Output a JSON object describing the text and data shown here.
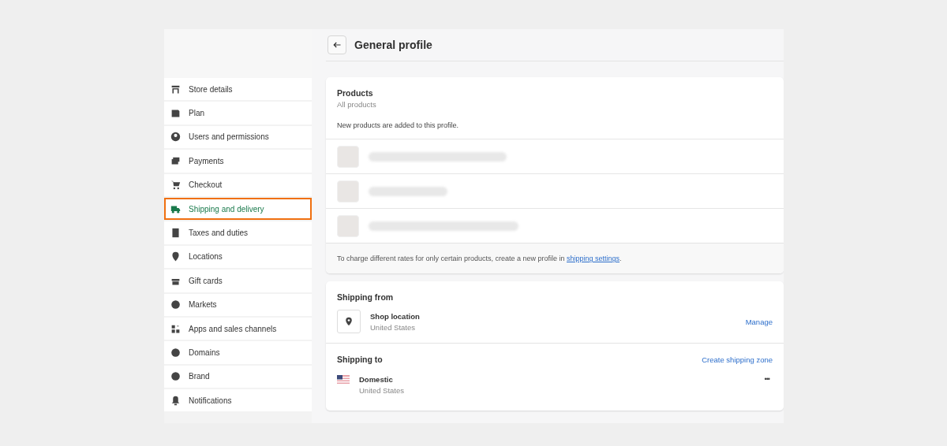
{
  "sidebar": {
    "items": [
      {
        "label": "Store details",
        "selected": false
      },
      {
        "label": "Plan",
        "selected": false
      },
      {
        "label": "Users and permissions",
        "selected": false
      },
      {
        "label": "Payments",
        "selected": false
      },
      {
        "label": "Checkout",
        "selected": false
      },
      {
        "label": "Shipping and delivery",
        "selected": true
      },
      {
        "label": "Taxes and duties",
        "selected": false
      },
      {
        "label": "Locations",
        "selected": false
      },
      {
        "label": "Gift cards",
        "selected": false
      },
      {
        "label": "Markets",
        "selected": false
      },
      {
        "label": "Apps and sales channels",
        "selected": false
      },
      {
        "label": "Domains",
        "selected": false
      },
      {
        "label": "Brand",
        "selected": false
      },
      {
        "label": "Notifications",
        "selected": false
      }
    ]
  },
  "header": {
    "title": "General profile"
  },
  "products": {
    "title": "Products",
    "subtitle": "All products",
    "note": "New products are added to this profile.",
    "rows": [
      {
        "kind": "blurred"
      },
      {
        "kind": "blurred"
      },
      {
        "kind": "blurred"
      }
    ],
    "footer": {
      "text": "To charge different rates for only certain products, create a new profile in ",
      "link": "shipping settings",
      "after": "."
    }
  },
  "shipping_from": {
    "title": "Shipping from",
    "location": {
      "name": "Shop location",
      "country": "United States"
    },
    "action": "Manage"
  },
  "shipping_to": {
    "title": "Shipping to",
    "action": "Create shipping zone",
    "zones": [
      {
        "name": "Domestic",
        "country": "United States",
        "menu": "•••"
      }
    ]
  }
}
